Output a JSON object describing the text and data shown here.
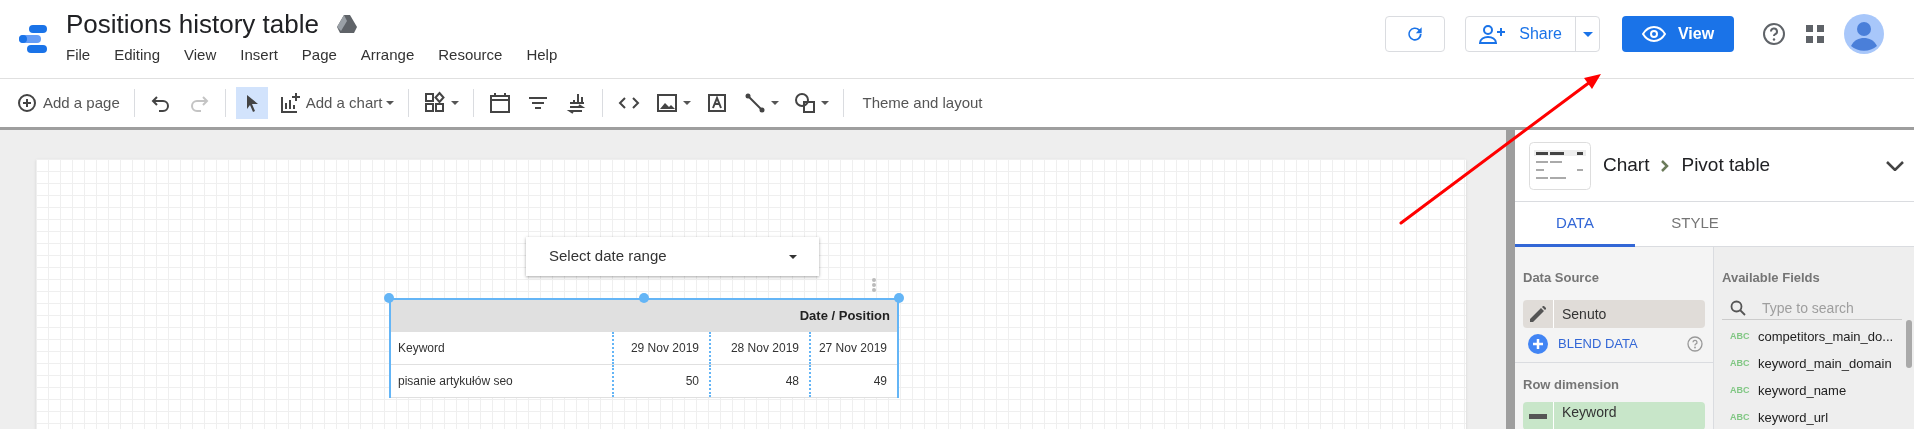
{
  "app": {
    "title": "Positions history table",
    "menu": [
      "File",
      "Editing",
      "View",
      "Insert",
      "Page",
      "Arrange",
      "Resource",
      "Help"
    ]
  },
  "header_buttons": {
    "share": "Share",
    "view": "View"
  },
  "toolbar": [
    {
      "kind": "add-page",
      "label": "Add a page",
      "selected": false,
      "disabled": false
    },
    {
      "kind": "undo",
      "selected": false,
      "disabled": false
    },
    {
      "kind": "redo",
      "selected": false,
      "disabled": true
    },
    {
      "kind": "select",
      "selected": true,
      "disabled": false
    },
    {
      "kind": "add-chart",
      "label": "Add a chart",
      "selected": false,
      "disabled": false
    },
    {
      "kind": "controls",
      "selected": false,
      "disabled": false
    },
    {
      "kind": "date",
      "selected": false,
      "disabled": false
    },
    {
      "kind": "filter",
      "selected": false,
      "disabled": false
    },
    {
      "kind": "data-control",
      "selected": false,
      "disabled": false
    },
    {
      "kind": "code",
      "selected": false,
      "disabled": false
    },
    {
      "kind": "image",
      "selected": false,
      "disabled": false
    },
    {
      "kind": "text",
      "selected": false,
      "disabled": false
    },
    {
      "kind": "line",
      "selected": false,
      "disabled": false
    },
    {
      "kind": "shape",
      "selected": false,
      "disabled": false
    },
    {
      "kind": "theme",
      "label": "Theme and layout",
      "selected": false,
      "disabled": false
    }
  ],
  "canvas": {
    "date_range": {
      "label": "Select date range"
    },
    "pivot_table": {
      "header": "Date / Position",
      "columns": [
        "Keyword",
        "29 Nov 2019",
        "28 Nov 2019",
        "27 Nov 2019"
      ],
      "rows": [
        [
          "pisanie artykułów seo",
          "50",
          "48",
          "49"
        ]
      ]
    }
  },
  "panel": {
    "breadcrumb": [
      "Chart",
      "Pivot table"
    ],
    "tabs": [
      {
        "label": "DATA",
        "selected": true
      },
      {
        "label": "STYLE",
        "selected": false
      }
    ],
    "data_source": {
      "heading": "Data Source",
      "name": "Senuto",
      "blend": "BLEND DATA"
    },
    "row_dimension": {
      "heading": "Row dimension",
      "field": "Keyword"
    },
    "available_fields": {
      "heading": "Available Fields",
      "placeholder": "Type to search",
      "fields": [
        {
          "type": "ABC",
          "name": "competitors_main_do..."
        },
        {
          "type": "ABC",
          "name": "keyword_main_domain"
        },
        {
          "type": "ABC",
          "name": "keyword_name"
        },
        {
          "type": "ABC",
          "name": "keyword_url"
        }
      ]
    }
  }
}
